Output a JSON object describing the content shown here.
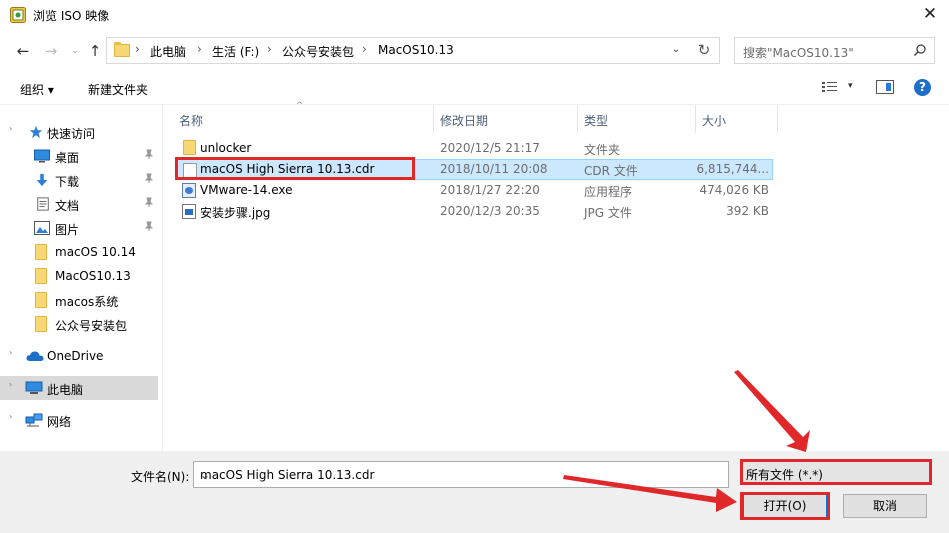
{
  "window": {
    "title": "浏览 ISO 映像",
    "close_glyph": "✕"
  },
  "nav": {
    "back_glyph": "←",
    "forward_glyph": "→",
    "recent_glyph": "⌄",
    "up_glyph": "↑",
    "breadcrumbs": [
      "此电脑",
      "生活 (F:)",
      "公众号安装包",
      "MacOS10.13"
    ],
    "separator": "›",
    "refresh_glyph": "↻",
    "search_placeholder": "搜索\"MacOS10.13\""
  },
  "toolbar": {
    "organize": "组织 ▾",
    "new_folder": "新建文件夹",
    "view_caret": "▾",
    "help": "?"
  },
  "sidebar": {
    "quick_access": "快速访问",
    "items": [
      {
        "label": "桌面",
        "icon": "desktop-icon",
        "pinned": true
      },
      {
        "label": "下载",
        "icon": "download-icon",
        "pinned": true
      },
      {
        "label": "文档",
        "icon": "document-icon",
        "pinned": true
      },
      {
        "label": "图片",
        "icon": "picture-icon",
        "pinned": true
      },
      {
        "label": "macOS 10.14",
        "icon": "folder-icon",
        "pinned": false
      },
      {
        "label": "MacOS10.13",
        "icon": "folder-icon",
        "pinned": false
      },
      {
        "label": "macos系统",
        "icon": "folder-icon",
        "pinned": false
      },
      {
        "label": "公众号安装包",
        "icon": "folder-icon",
        "pinned": false
      }
    ],
    "onedrive": "OneDrive",
    "this_pc": "此电脑",
    "network": "网络",
    "pin_glyph": "📌"
  },
  "columns": {
    "name": "名称",
    "modified": "修改日期",
    "type": "类型",
    "size": "大小",
    "sort_glyph": "^"
  },
  "files": [
    {
      "name": "unlocker",
      "modified": "2020/12/5 21:17",
      "type": "文件夹",
      "size": "",
      "icon": "folder-icon"
    },
    {
      "name": "macOS High Sierra 10.13.cdr",
      "modified": "2018/10/11 20:08",
      "type": "CDR 文件",
      "size": "6,815,744...",
      "icon": "file-icon"
    },
    {
      "name": "VMware-14.exe",
      "modified": "2018/1/27 22:20",
      "type": "应用程序",
      "size": "474,026 KB",
      "icon": "exe-icon"
    },
    {
      "name": "安装步骤.jpg",
      "modified": "2020/12/3 20:35",
      "type": "JPG 文件",
      "size": "392 KB",
      "icon": "image-icon"
    }
  ],
  "footer": {
    "filename_label": "文件名(N):",
    "filename_value": "macOS High Sierra 10.13.cdr",
    "filetype_value": "所有文件 (*.*)",
    "dropdown_glyph": "⌄",
    "open_button": "打开(O)",
    "cancel_button": "取消"
  },
  "colors": {
    "annotation_red": "#e0282b",
    "selection_bg": "#cce8ff",
    "selection_border": "#99d1ff",
    "accent": "#0078d7"
  }
}
